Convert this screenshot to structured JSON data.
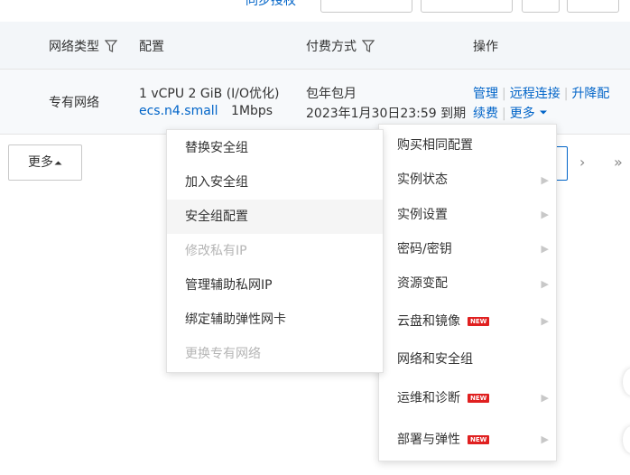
{
  "top": {
    "link_label": "同步授权"
  },
  "table": {
    "headers": {
      "network_type": "网络类型",
      "config": "配置",
      "billing": "付费方式",
      "actions": "操作"
    },
    "row": {
      "network_type": "专有网络",
      "config_line1": "1 vCPU 2 GiB  (I/O优化)",
      "instance_type": "ecs.n4.small",
      "bandwidth": "1Mbps",
      "billing_line1": "包年包月",
      "billing_line2": "2023年1月30日23:59 到期",
      "actions": {
        "manage": "管理",
        "remote": "远程连接",
        "upgrade": "升降配",
        "renew": "续费",
        "more": "更多"
      }
    }
  },
  "bottom": {
    "more_label": "更多"
  },
  "pagination": {
    "next": "›",
    "last": "»"
  },
  "security_menu": {
    "items": [
      {
        "label": "替换安全组",
        "state": "normal"
      },
      {
        "label": "加入安全组",
        "state": "normal"
      },
      {
        "label": "安全组配置",
        "state": "hover"
      },
      {
        "label": "修改私有IP",
        "state": "disabled"
      },
      {
        "label": "管理辅助私网IP",
        "state": "normal"
      },
      {
        "label": "绑定辅助弹性网卡",
        "state": "normal"
      },
      {
        "label": "更换专有网络",
        "state": "disabled"
      }
    ]
  },
  "more_menu": {
    "new_badge": "NEW",
    "items": [
      {
        "label": "购买相同配置",
        "submenu": false,
        "new": false
      },
      {
        "label": "实例状态",
        "submenu": true,
        "new": false
      },
      {
        "label": "实例设置",
        "submenu": true,
        "new": false
      },
      {
        "label": "密码/密钥",
        "submenu": true,
        "new": false
      },
      {
        "label": "资源变配",
        "submenu": true,
        "new": false
      },
      {
        "label": "云盘和镜像",
        "submenu": true,
        "new": true
      },
      {
        "label": "网络和安全组",
        "submenu": false,
        "new": false
      },
      {
        "label": "运维和诊断",
        "submenu": true,
        "new": true
      },
      {
        "label": "部署与弹性",
        "submenu": true,
        "new": true
      }
    ]
  },
  "colors": {
    "link": "#0064c8",
    "header_bg": "#f3f6f9",
    "badge": "#e02020"
  }
}
